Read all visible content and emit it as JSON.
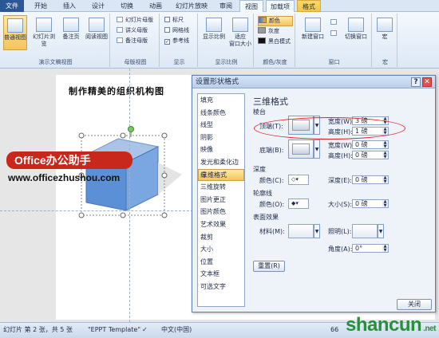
{
  "tabs": [
    "文件",
    "开始",
    "插入",
    "设计",
    "切换",
    "动画",
    "幻灯片放映",
    "审阅",
    "视图",
    "加载项",
    "格式"
  ],
  "ribbon": {
    "views": {
      "normal": "普通视图",
      "sorter": "幻灯片浏览",
      "notes": "备注页",
      "reading": "阅读视图",
      "label": "演示文稿视图"
    },
    "master": {
      "slide": "幻灯片母版",
      "handout": "讲义母版",
      "notes": "备注母版",
      "label": "母版视图"
    },
    "show": {
      "ruler": "标尺",
      "grid": "网格线",
      "guides": "参考线",
      "label": "显示"
    },
    "zoom": {
      "zoom": "显示比例",
      "fit": "适应\n窗口大小",
      "label": "显示比例"
    },
    "color": {
      "color": "颜色",
      "gray": "灰度",
      "bw": "黑白模式",
      "label": "颜色/灰度"
    },
    "window": {
      "new": "新建窗口",
      "switch": "切换窗口",
      "label": "窗口"
    },
    "macro": {
      "macro": "宏",
      "label": "宏"
    }
  },
  "slide": {
    "title": "制作精美的组织机构图"
  },
  "watermark": {
    "brand": "Office办公助手",
    "url": "www.officezhushou.com"
  },
  "dialog": {
    "title": "设置形状格式",
    "nav": [
      "填充",
      "线条颜色",
      "线型",
      "阴影",
      "映像",
      "发光和柔化边缘",
      "三维格式",
      "三维旋转",
      "图片更正",
      "图片颜色",
      "艺术效果",
      "裁剪",
      "大小",
      "位置",
      "文本框",
      "可选文字"
    ],
    "selected_nav": "三维格式",
    "pane_title": "三维格式",
    "bevel": {
      "section": "棱台",
      "top": "顶端(T):",
      "bottom": "底端(B):",
      "width": "宽度(W):",
      "height": "高度(H):",
      "top_width": "3 磅",
      "top_height": "1 磅",
      "bottom_width": "0 磅",
      "bottom_height": "0 磅"
    },
    "depth": {
      "section": "深度",
      "color": "颜色(C):",
      "depth": "深度(E):",
      "value": "0 磅"
    },
    "contour": {
      "section": "轮廓线",
      "color": "颜色(O):",
      "size": "大小(S):",
      "value": "0 磅"
    },
    "surface": {
      "section": "表面效果",
      "material": "材料(M):",
      "lighting": "照明(L):",
      "angle": "角度(A):",
      "angle_value": "0°"
    },
    "reset": "重置(R)",
    "close": "关闭"
  },
  "status": {
    "slide": "幻灯片 第 2 张，共 5 张",
    "template": "\"EPPT Template\"",
    "lang": "中文(中国)",
    "zoom": "66"
  },
  "logo": {
    "text": "shancun",
    "domain": ".net"
  },
  "colors": {
    "file_tab": "#2b5797",
    "format_tab": "#f2c649",
    "accent": "#d8242a",
    "logo": "#2a8f3d"
  }
}
